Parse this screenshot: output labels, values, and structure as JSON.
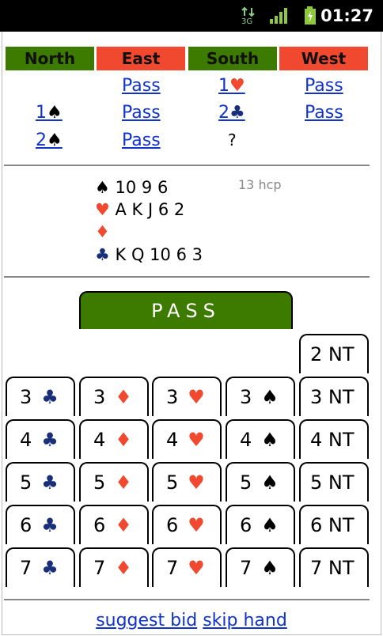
{
  "status_bar": {
    "clock": "01:27",
    "network": "3G"
  },
  "auction": {
    "headers": [
      "North",
      "East",
      "South",
      "West"
    ],
    "rows": [
      {
        "east": "Pass",
        "south_level": "1",
        "south_suit": "♥",
        "west": "Pass"
      },
      {
        "north_level": "1",
        "north_suit": "♠",
        "east": "Pass",
        "south_level": "2",
        "south_suit": "♣",
        "west": "Pass"
      },
      {
        "north_level": "2",
        "north_suit": "♠",
        "east": "Pass",
        "south": "?"
      }
    ]
  },
  "hand": {
    "spades": {
      "symbol": "♠",
      "cards": "10 9 6"
    },
    "hearts": {
      "symbol": "♥",
      "cards": "A K J 6 2"
    },
    "diamonds": {
      "symbol": "♦",
      "cards": ""
    },
    "clubs": {
      "symbol": "♣",
      "cards": "K Q 10 6 3"
    },
    "hcp": "13 hcp"
  },
  "bidding": {
    "pass_label": "PASS",
    "nt2": "2 NT",
    "levels": [
      "3",
      "4",
      "5",
      "6",
      "7"
    ],
    "suits": [
      "♣",
      "♦",
      "♥",
      "♠"
    ],
    "nt_label": "NT"
  },
  "footer": {
    "suggest": "suggest bid",
    "skip": "skip hand"
  },
  "colors": {
    "green": "#3d7a00",
    "red": "#f0492f",
    "club": "#1a2f7a",
    "link": "#1133cc"
  }
}
